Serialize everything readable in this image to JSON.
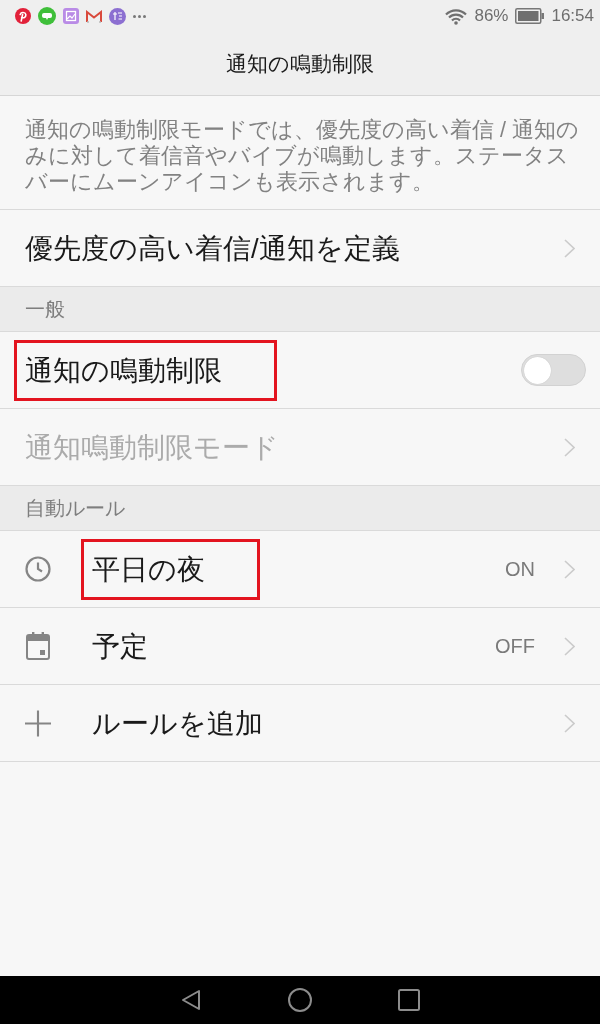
{
  "status_bar": {
    "battery": "86%",
    "time": "16:54"
  },
  "header": {
    "title": "通知の鳴動制限"
  },
  "description": "通知の鳴動制限モードでは、優先度の高い着信 / 通知のみに対して着信音やバイブが鳴動します。ステータスバーにムーンアイコンも表示されます。",
  "sections": [
    {
      "items": [
        {
          "kind": "link",
          "label": "優先度の高い着信/通知を定義",
          "disabled": false,
          "highlighted": false
        }
      ]
    },
    {
      "title": "一般",
      "items": [
        {
          "kind": "toggle",
          "label": "通知の鳴動制限",
          "on": false,
          "disabled": false,
          "highlighted": true
        },
        {
          "kind": "link",
          "label": "通知鳴動制限モード",
          "disabled": true,
          "highlighted": false
        }
      ]
    },
    {
      "title": "自動ルール",
      "items": [
        {
          "kind": "time_rule",
          "label": "平日の夜",
          "value": "ON",
          "disabled": false,
          "highlighted": true
        },
        {
          "kind": "event_rule",
          "label": "予定",
          "value": "OFF",
          "disabled": false,
          "highlighted": false
        },
        {
          "kind": "add_rule",
          "label": "ルールを追加",
          "disabled": false,
          "highlighted": false
        }
      ]
    }
  ]
}
